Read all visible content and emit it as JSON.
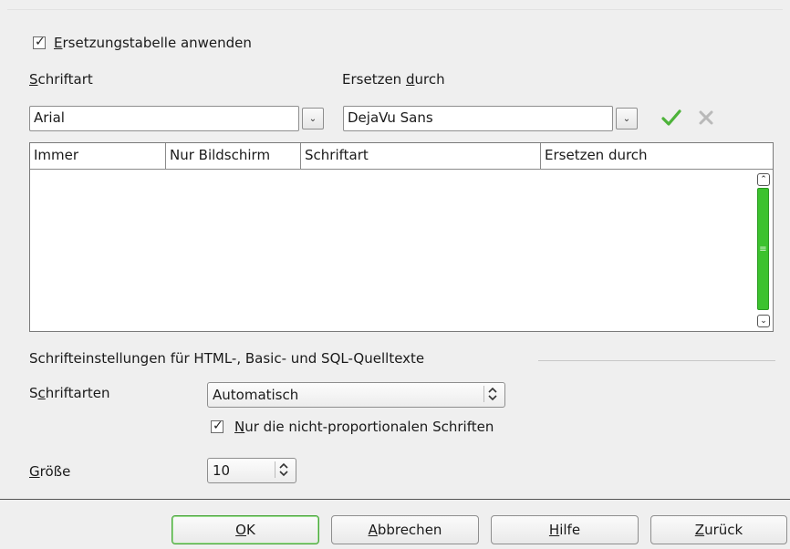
{
  "replacement_table": {
    "checkbox_label_prefix": "E",
    "checkbox_label_rest": "rsetzungstabelle anwenden",
    "checked": true
  },
  "font_label_prefix": "S",
  "font_label_rest": "chriftart",
  "replace_label_prefix": "Ersetzen ",
  "replace_label_ul": "d",
  "replace_label_rest": "urch",
  "font_value": "Arial",
  "replace_value": "DejaVu Sans",
  "table": {
    "headers": [
      "Immer",
      "Nur Bildschirm",
      "Schriftart",
      "Ersetzen durch"
    ],
    "rows": []
  },
  "source_section": {
    "title": "Schrifteinstellungen für HTML-, Basic- und SQL-Quelltexte",
    "fonts_label_prefix": "S",
    "fonts_label_ul": "c",
    "fonts_label_rest": "hriftarten",
    "fonts_value": "Automatisch",
    "nonprop_ul": "N",
    "nonprop_rest": "ur die nicht-proportionalen Schriften",
    "nonprop_checked": true,
    "size_label_ul": "G",
    "size_label_rest": "röße",
    "size_value": "10"
  },
  "buttons": {
    "ok_ul": "O",
    "ok_rest": "K",
    "cancel_ul": "A",
    "cancel_rest": "bbrechen",
    "help_ul": "H",
    "help_rest": "ilfe",
    "back_ul": "Z",
    "back_rest": "urück"
  },
  "icons": {
    "apply": "check-icon",
    "delete": "delete-icon",
    "accent_green": "#3cc22e"
  }
}
